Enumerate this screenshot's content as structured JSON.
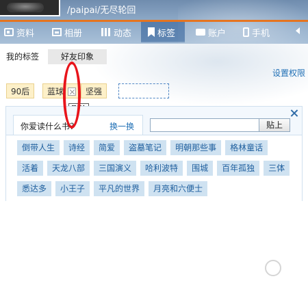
{
  "header": {
    "username": "/paipai/无尽轮回"
  },
  "nav": {
    "items": [
      {
        "label": "资料",
        "icon": "profile-card-icon"
      },
      {
        "label": "相册",
        "icon": "photo-album-icon"
      },
      {
        "label": "动态",
        "icon": "activity-grid-icon"
      },
      {
        "label": "标签",
        "icon": "bookmark-icon",
        "active": true
      },
      {
        "label": "账户",
        "icon": "briefcase-icon"
      },
      {
        "label": "手机",
        "icon": "phone-icon"
      }
    ]
  },
  "subtabs": {
    "my": "我的标签",
    "friend": "好友印象"
  },
  "permission_link": "设置权限",
  "tags": [
    "90后",
    "蓝球",
    "坚强"
  ],
  "tooltip": "删除",
  "panel": {
    "title": "你爱读什么书？",
    "refresh": "换一换",
    "search_value": "",
    "paste_button": "贴上",
    "books_row1": [
      "倒带人生",
      "诗经",
      "简爱",
      "盗墓笔记",
      "明朝那些事",
      "格林童话"
    ],
    "books_row2": [
      "活着",
      "天龙八部",
      "三国演义",
      "哈利波特",
      "围城",
      "百年孤独",
      "三体"
    ],
    "books_row3": [
      "悉达多",
      "小王子",
      "平凡的世界",
      "月亮和六便士"
    ]
  },
  "colors": {
    "accent_orange": "#e6741f",
    "link_blue": "#1f6fb5",
    "highlight_red": "#e8141b"
  }
}
